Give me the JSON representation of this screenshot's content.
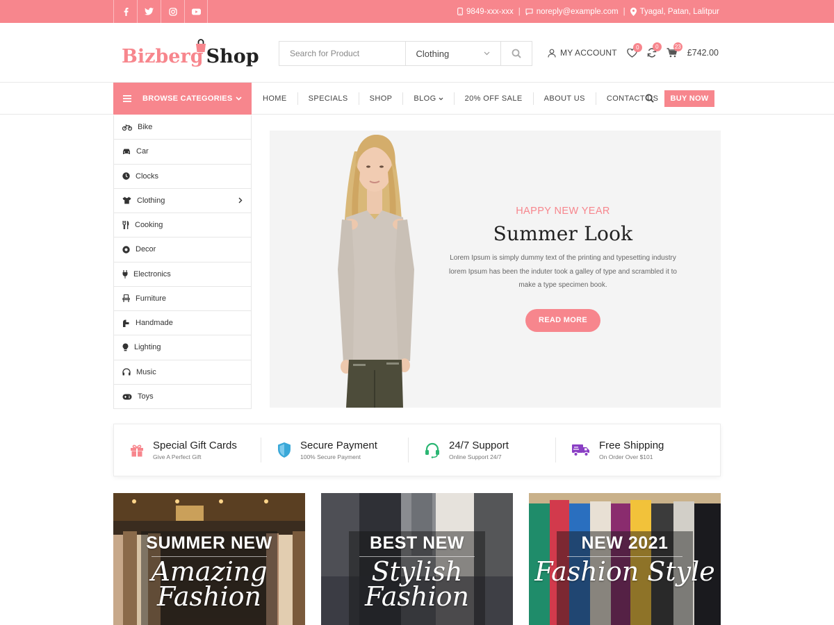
{
  "topbar": {
    "phone": "9849-xxx-xxx",
    "email": "noreply@example.com",
    "location": "Tyagal, Patan, Lalitpur",
    "social": [
      "facebook-icon",
      "twitter-icon",
      "instagram-icon",
      "youtube-icon"
    ]
  },
  "header": {
    "logo_part1": "Bizberg",
    "logo_part2": "Shop",
    "search_placeholder": "Search for Product",
    "search_category": "Clothing",
    "account_label": "MY ACCOUNT",
    "wishlist_count": "0",
    "compare_count": "0",
    "cart_count": "23",
    "cart_total": "£742.00"
  },
  "nav": {
    "browse_label": "BROWSE CATEGORIES",
    "items": [
      "HOME",
      "SPECIALS",
      "SHOP",
      "BLOG",
      "20% OFF SALE",
      "ABOUT US",
      "CONTACT US"
    ],
    "buy_now": "BUY NOW"
  },
  "categories": [
    {
      "label": "Bike",
      "icon": "bike-icon"
    },
    {
      "label": "Car",
      "icon": "car-icon"
    },
    {
      "label": "Clocks",
      "icon": "clock-icon"
    },
    {
      "label": "Clothing",
      "icon": "tshirt-icon"
    },
    {
      "label": "Cooking",
      "icon": "cutlery-icon"
    },
    {
      "label": "Decor",
      "icon": "decor-icon"
    },
    {
      "label": "Electronics",
      "icon": "plug-icon"
    },
    {
      "label": "Furniture",
      "icon": "chair-icon"
    },
    {
      "label": "Handmade",
      "icon": "handmade-icon"
    },
    {
      "label": "Lighting",
      "icon": "bulb-icon"
    },
    {
      "label": "Music",
      "icon": "headphones-icon"
    },
    {
      "label": "Toys",
      "icon": "gamepad-icon"
    }
  ],
  "hero": {
    "pretitle": "HAPPY NEW YEAR",
    "title": "Summer Look",
    "description": "Lorem Ipsum is simply dummy text of the printing and typesetting industry lorem Ipsum has been the induter took a galley of type and scrambled it to make a type specimen book.",
    "button": "READ MORE"
  },
  "features": [
    {
      "title": "Special Gift Cards",
      "subtitle": "Give A Perfect Gift",
      "icon": "gift-icon",
      "color": "#f7868d"
    },
    {
      "title": "Secure Payment",
      "subtitle": "100% Secure Payment",
      "icon": "shield-icon",
      "color": "#3aa8d8"
    },
    {
      "title": "24/7 Support",
      "subtitle": "Online Support 24/7",
      "icon": "headset-icon",
      "color": "#2bb673"
    },
    {
      "title": "Free Shipping",
      "subtitle": "On Order Over $101",
      "icon": "truck-icon",
      "color": "#8a3fc4"
    }
  ],
  "banners": [
    {
      "top": "SUMMER NEW",
      "script": "Amazing Fashion"
    },
    {
      "top": "BEST NEW",
      "script": "Stylish Fashion"
    },
    {
      "top": "NEW 2021",
      "script": "Fashion Style"
    }
  ],
  "colors": {
    "accent": "#f7868d"
  }
}
